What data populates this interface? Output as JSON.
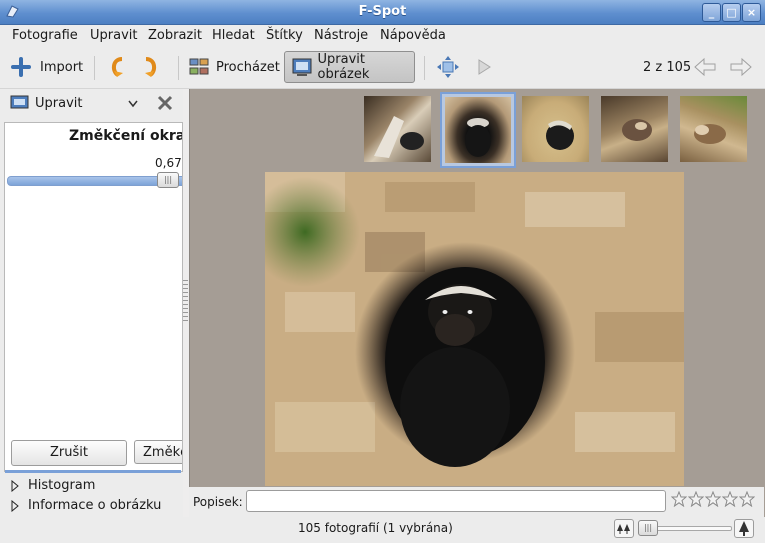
{
  "window": {
    "title": "F-Spot"
  },
  "menubar": {
    "items": [
      "Fotografie",
      "Upravit",
      "Zobrazit",
      "Hledat",
      "Štítky",
      "Nástroje",
      "Nápověda"
    ]
  },
  "toolbar": {
    "import_label": "Import",
    "browse_label": "Procházet",
    "edit_label": "Upravit obrázek",
    "position": "2 z 105"
  },
  "sidebar": {
    "mode_label": "Upravit",
    "tool_title": "Změkčení okraj",
    "slider_value": "0,67",
    "slider_fraction": 0.67,
    "cancel_label": "Zrušit",
    "apply_label": "Změkč",
    "expanders": [
      "Histogram",
      "Informace o obrázku"
    ]
  },
  "main": {
    "caption_label": "Popisek:",
    "caption_value": "",
    "rating": 0,
    "rating_max": 5
  },
  "status": {
    "text": "105 fotografií (1 vybrána)"
  },
  "colors": {
    "titlebar": "#5f8fcf",
    "selection": "#7aa0d8",
    "photo_bg": "#a59d95"
  }
}
